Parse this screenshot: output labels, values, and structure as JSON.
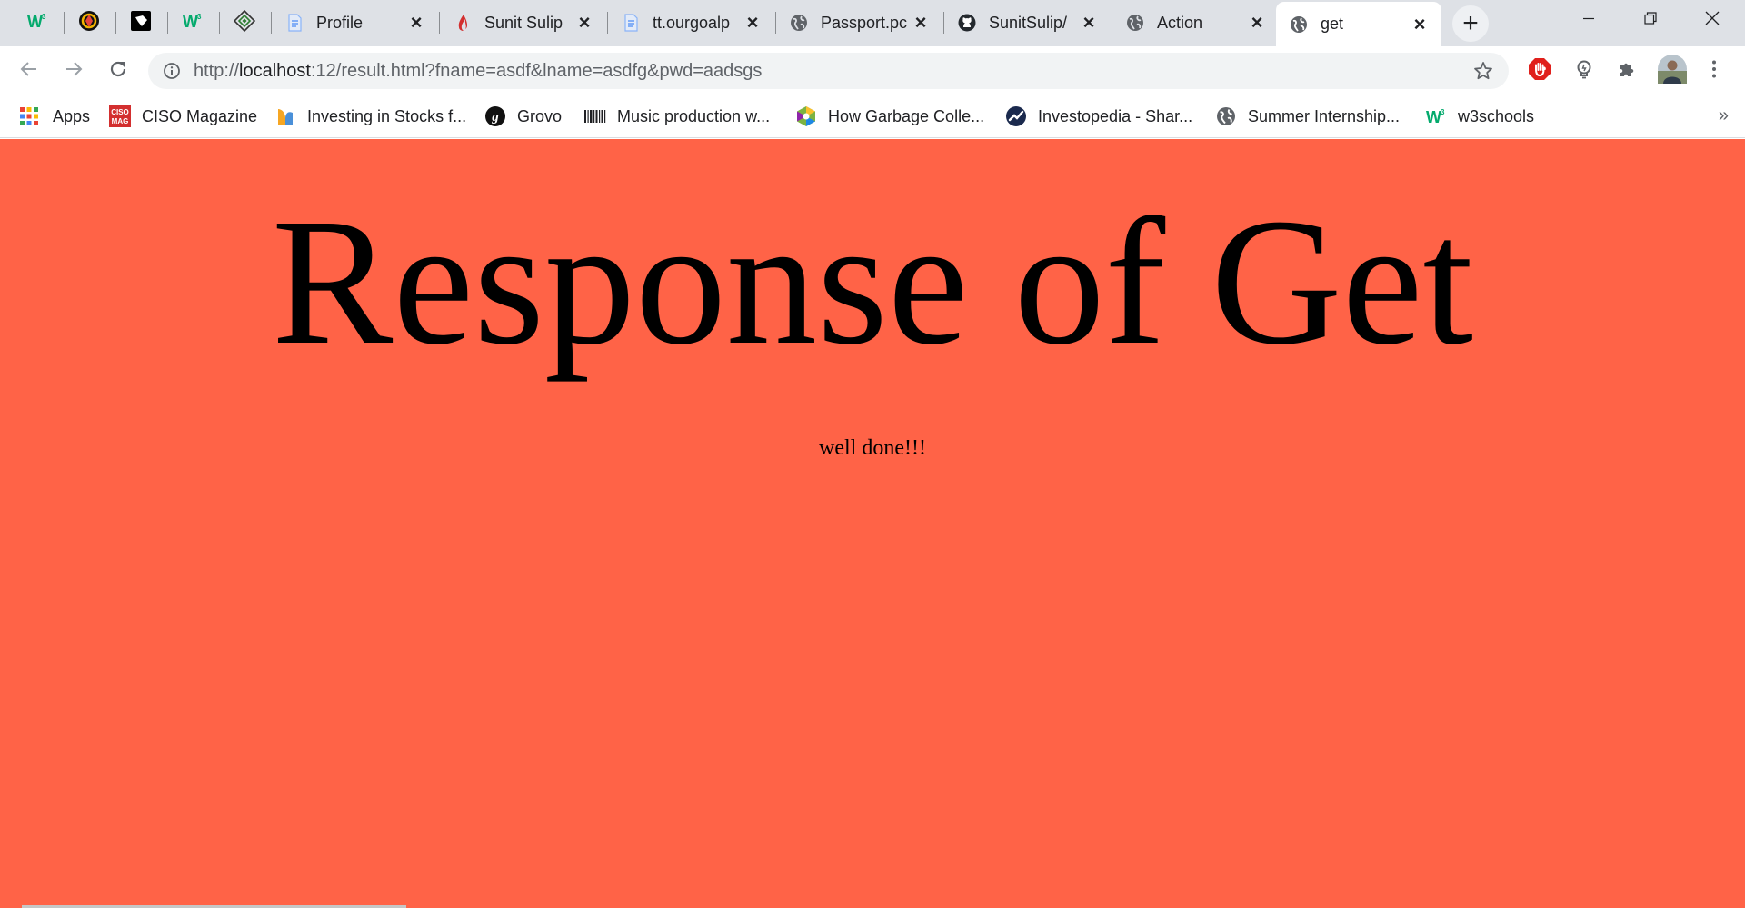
{
  "tabs": {
    "pinned": [
      {
        "icon": "w3schools-icon"
      },
      {
        "icon": "aperture-logo-icon"
      },
      {
        "icon": "black-shield-logo-icon"
      },
      {
        "icon": "w3schools-icon"
      },
      {
        "icon": "green-diamond-logo-icon"
      }
    ],
    "items": [
      {
        "title": "Profile",
        "icon": "document-icon"
      },
      {
        "title": "Sunit Sulip",
        "icon": "flame-icon"
      },
      {
        "title": "tt.ourgoalp",
        "icon": "document-icon"
      },
      {
        "title": "Passport.pc",
        "icon": "globe-icon"
      },
      {
        "title": "SunitSulip/",
        "icon": "github-icon"
      },
      {
        "title": "Action",
        "icon": "globe-icon"
      },
      {
        "title": "get",
        "icon": "globe-icon",
        "active": true
      }
    ],
    "close_glyph": "×",
    "new_tab_glyph": "+"
  },
  "window_controls": {
    "minimize": "minimize-icon",
    "restore": "restore-icon",
    "close": "close-icon"
  },
  "toolbar": {
    "url_prefix": "http://",
    "url_host": "localhost",
    "url_rest": ":12/result.html?fname=asdf&lname=asdfg&pwd=aadsgs"
  },
  "bookmarks": [
    {
      "label": "Apps",
      "icon": "apps-grid-icon"
    },
    {
      "label": "CISO Magazine",
      "icon": "ciso-mag-icon"
    },
    {
      "label": "Investing in Stocks f...",
      "icon": "stocks-icon"
    },
    {
      "label": "Grovo",
      "icon": "grovo-icon"
    },
    {
      "label": "Music production w...",
      "icon": "barcode-icon"
    },
    {
      "label": "How Garbage Colle...",
      "icon": "hexagon-icon"
    },
    {
      "label": "Investopedia - Shar...",
      "icon": "investopedia-icon"
    },
    {
      "label": "Summer Internship...",
      "icon": "globe-icon"
    },
    {
      "label": "w3schools",
      "icon": "w3schools-icon"
    }
  ],
  "bookmarks_overflow": "»",
  "page": {
    "heading": "Response of Get",
    "message": "well done!!!",
    "background": "#ff6347"
  }
}
